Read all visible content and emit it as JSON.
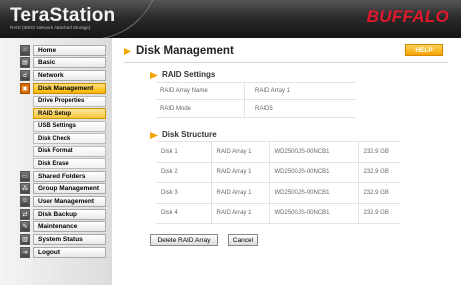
{
  "header": {
    "logo": "TeraStation",
    "logo_sub": "RAID (IDE/S Network Attached Storage)",
    "brand": "BUFFALO"
  },
  "sidebar": {
    "items": [
      {
        "label": "Home",
        "icon": "home-icon"
      },
      {
        "label": "Basic",
        "icon": "basic-icon"
      },
      {
        "label": "Network",
        "icon": "network-icon"
      },
      {
        "label": "Disk Management",
        "icon": "disk-icon",
        "active": true
      },
      {
        "label": "Shared Folders",
        "icon": "folders-icon"
      },
      {
        "label": "Group Management",
        "icon": "group-icon"
      },
      {
        "label": "User Management",
        "icon": "user-icon"
      },
      {
        "label": "Disk Backup",
        "icon": "backup-icon"
      },
      {
        "label": "Maintenance",
        "icon": "maintenance-icon"
      },
      {
        "label": "System Status",
        "icon": "status-icon"
      },
      {
        "label": "Logout",
        "icon": "logout-icon"
      }
    ],
    "sub_items": [
      {
        "label": "Drive Properties"
      },
      {
        "label": "RAID Setup",
        "active": true
      },
      {
        "label": "USB Settings"
      },
      {
        "label": "Disk Check"
      },
      {
        "label": "Disk Format"
      },
      {
        "label": "Disk Erase"
      }
    ]
  },
  "main": {
    "title": "Disk Management",
    "help": "HELP",
    "raid_settings": {
      "title": "RAID Settings",
      "rows": [
        {
          "key": "RAID Array Name",
          "value": "RAID Array 1"
        },
        {
          "key": "RAID Mode",
          "value": "RAID5"
        }
      ]
    },
    "disk_structure": {
      "title": "Disk Structure",
      "rows": [
        [
          "Disk 1",
          "RAID Array 1",
          "WD2500JS-00NCB1",
          "232.9 GB"
        ],
        [
          "Disk 2",
          "RAID Array 1",
          "WD2500JS-00NCB1",
          "232.9 GB"
        ],
        [
          "Disk 3",
          "RAID Array 1",
          "WD2500JS-00NCB1",
          "232.9 GB"
        ],
        [
          "Disk 4",
          "RAID Array 1",
          "WD2500JS-00NCB1",
          "232.9 GB"
        ]
      ]
    },
    "buttons": {
      "delete": "Delete RAID Array",
      "cancel": "Cancel"
    }
  },
  "colors": {
    "accent": "#f4a300",
    "brand": "#e0182d",
    "active_nav": "#f7b500"
  }
}
